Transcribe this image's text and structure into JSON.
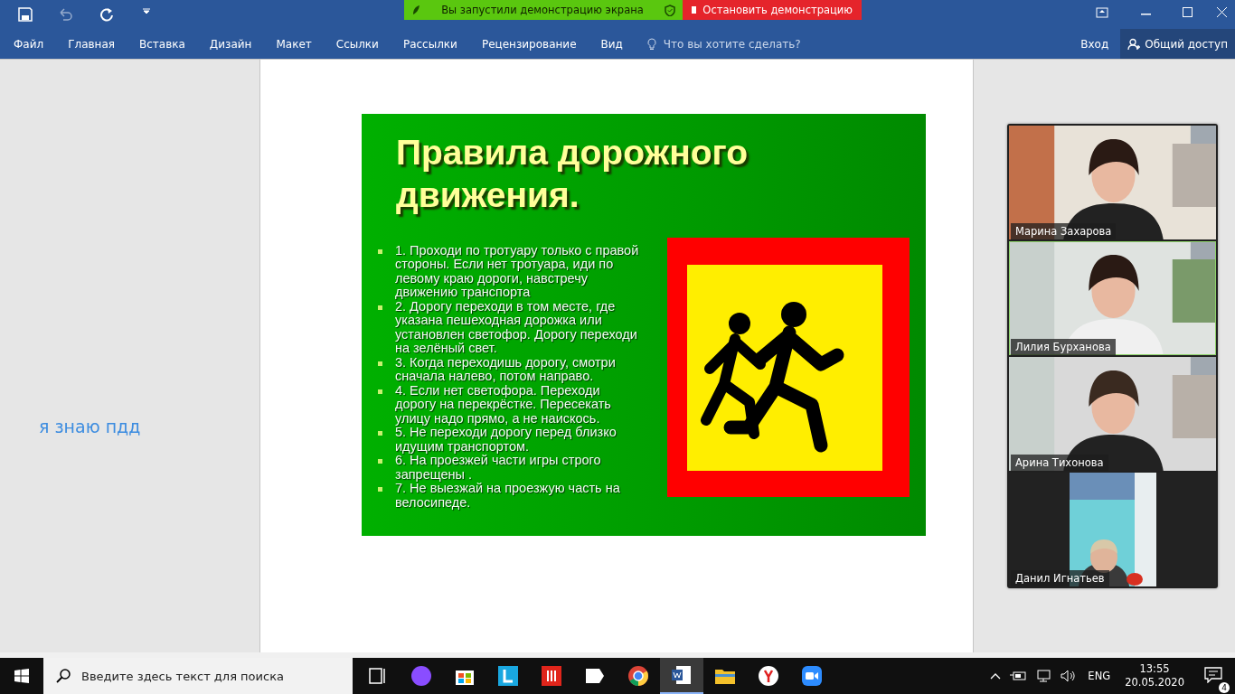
{
  "share_bar": {
    "message": "Вы запустили демонстрацию экрана",
    "stop_button": "Остановить демонстрацию"
  },
  "ribbon": {
    "tabs": [
      {
        "label": "Файл",
        "selected": false
      },
      {
        "label": "Главная",
        "selected": false
      },
      {
        "label": "Вставка",
        "selected": false
      },
      {
        "label": "Дизайн",
        "selected": false
      },
      {
        "label": "Макет",
        "selected": false
      },
      {
        "label": "Ссылки",
        "selected": false
      },
      {
        "label": "Рассылки",
        "selected": false
      },
      {
        "label": "Рецензирование",
        "selected": false
      },
      {
        "label": "Вид",
        "selected": false
      }
    ],
    "tell_me": {
      "placeholder": "Что вы хотите сделать?"
    },
    "sign_in": "Вход",
    "share": "Общий доступ"
  },
  "side_text": "я знаю пдд",
  "slide": {
    "title": "Правила дорожного движения.",
    "items": [
      "1. Проходи по тротуару только с правой стороны. Если нет тротуара, иди по левому краю дороги, навстречу движению транспорта",
      "2.  Дорогу переходи в том месте, где указана пешеходная дорожка или установлен светофор. Дорогу переходи  на зелёный свет.",
      "3. Когда переходишь дорогу, смотри сначала налево, потом  направо.",
      "4. Если нет светофора. Переходи дорогу на перекрёстке. Пересекать улицу надо прямо, а не наискось.",
      "5. Не переходи дорогу перед близко идущим транспортом.",
      "6. На проезжей части игры строго запрещены .",
      "7. Не выезжай на проезжую часть на велосипеде."
    ]
  },
  "video_panel": {
    "participants": [
      {
        "name": "Марина Захарова",
        "speaking": false,
        "kind": "wide"
      },
      {
        "name": "Лилия Бурханова",
        "speaking": true,
        "kind": "wide"
      },
      {
        "name": "Арина Тихонова",
        "speaking": false,
        "kind": "wide"
      },
      {
        "name": "Данил Игнатьев",
        "speaking": false,
        "kind": "portrait"
      }
    ]
  },
  "taskbar": {
    "search": {
      "placeholder": "Введите здесь текст для поиска"
    },
    "apps": [
      {
        "kind": "taskview",
        "selected": false
      },
      {
        "kind": "alice",
        "selected": false
      },
      {
        "kind": "store",
        "selected": false
      },
      {
        "kind": "l",
        "selected": false
      },
      {
        "kind": "bars",
        "selected": false
      },
      {
        "kind": "ya",
        "selected": false
      },
      {
        "kind": "chrome",
        "selected": false
      },
      {
        "kind": "word",
        "selected": true
      },
      {
        "kind": "folder",
        "selected": false
      },
      {
        "kind": "ybrowser",
        "selected": false
      },
      {
        "kind": "zoom",
        "selected": false
      }
    ],
    "language": "ENG",
    "time": "13:55",
    "date": "20.05.2020",
    "notifications": "4"
  }
}
